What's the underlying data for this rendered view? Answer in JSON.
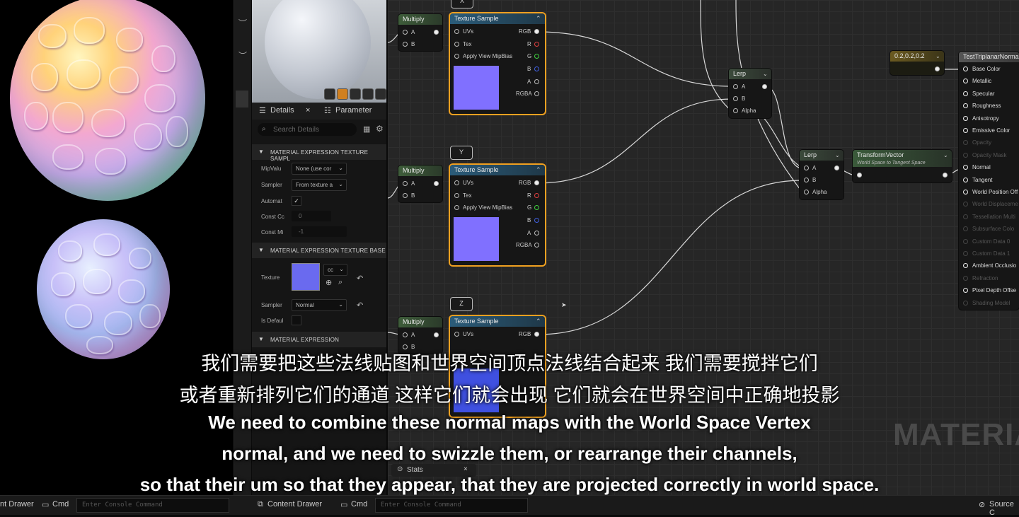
{
  "panel": {
    "tab_details": "Details",
    "tab_parameter": "Parameter",
    "search_placeholder": "Search Details",
    "section1": "MATERIAL EXPRESSION TEXTURE SAMPL",
    "mipvalue_label": "MipValu",
    "mipvalue_value": "None (use cor",
    "sampler_label": "Sampler",
    "sampler_value": "From texture a",
    "automat_label": "Automat",
    "constc_label": "Const Cc",
    "constc_value": "0",
    "constmi_label": "Const Mi",
    "constmi_value": "-1",
    "section2": "MATERIAL EXPRESSION TEXTURE BASE",
    "texture_label": "Texture",
    "texture_combo": "cc",
    "sampler2_label": "Sampler",
    "sampler2_value": "Normal",
    "isdefault_label": "Is Defaul",
    "section3": "MATERIAL EXPRESSION"
  },
  "graph": {
    "multiply": "Multiply",
    "texture_sample": "Texture Sample",
    "pin_a": "A",
    "pin_b": "B",
    "pin_uvs": "UVs",
    "pin_tex": "Tex",
    "pin_mip": "Apply View MipBias",
    "out_rgb": "RGB",
    "out_r": "R",
    "out_g": "G",
    "out_b": "B",
    "out_a": "A",
    "out_rgba": "RGBA",
    "letter_x": "X",
    "letter_y": "Y",
    "letter_z": "Z",
    "lerp": "Lerp",
    "pin_alpha": "Alpha",
    "const_value": "0.2,0.2,0.2",
    "transform_title": "TransformVector",
    "transform_sub": "World Space to Tangent Space",
    "result_title": "TestTriplanarNorma",
    "result_pins": [
      "Base Color",
      "Metallic",
      "Specular",
      "Roughness",
      "Anisotropy",
      "Emissive Color",
      "Opacity",
      "Opacity Mask",
      "Normal",
      "Tangent",
      "World Position Off",
      "World Displaceme",
      "Tessellation Multi",
      "Subsurface Colo",
      "Custom Data 0",
      "Custom Data 1",
      "Ambient Occlusio",
      "Refraction",
      "Pixel Depth Offse",
      "Shading Model"
    ],
    "watermark": "MATERIA"
  },
  "subtitles": {
    "cn1": "我们需要把这些法线贴图和世界空间顶点法线结合起来 我们需要搅拌它们",
    "cn2": "或者重新排列它们的通道 这样它们就会出现 它们就会在世界空间中正确地投影",
    "en1": "We need to combine these normal maps with the World Space Vertex",
    "en2": "normal, and we need to swizzle them, or rearrange their channels,",
    "en3": "so that their um so that they appear, that they are projected correctly in world space."
  },
  "bottom": {
    "drawer_left": "nt Drawer",
    "cmd_left": "Cmd",
    "console_placeholder": "Enter Console Command",
    "content_drawer": "Content Drawer",
    "cmd_mid": "Cmd",
    "source_control": "Source C",
    "stats": "Stats"
  }
}
